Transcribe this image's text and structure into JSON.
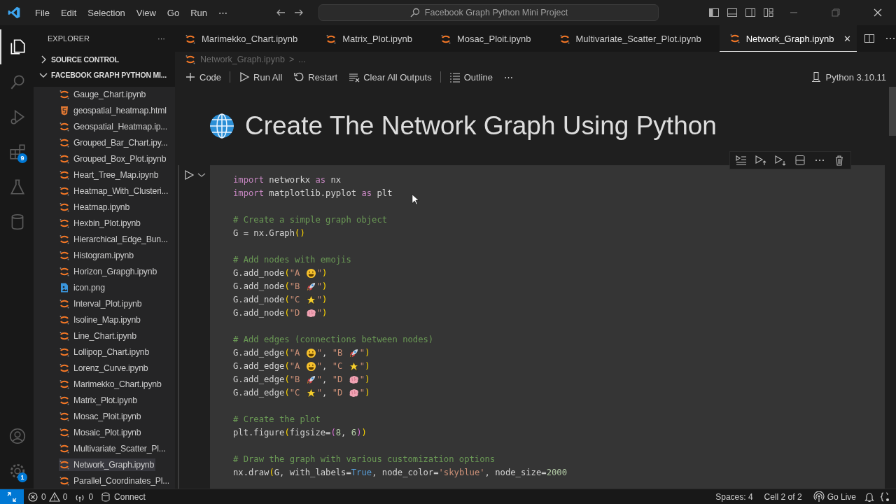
{
  "menu": [
    "File",
    "Edit",
    "Selection",
    "View",
    "Go",
    "Run",
    "⋯"
  ],
  "search": {
    "value": "Facebook Graph Python Mini Project"
  },
  "activity": [
    {
      "selected": true
    },
    {
      "selected": false
    },
    {
      "selected": false
    },
    {
      "selected": false,
      "badge": "9"
    },
    {
      "selected": false
    },
    {
      "selected": false
    }
  ],
  "activity_bottom": [
    {
      "selected": false
    },
    {
      "selected": false,
      "badge": "1"
    }
  ],
  "explorer": {
    "title": "EXPLORER",
    "more": "···",
    "sections": [
      {
        "label": "SOURCE CONTROL",
        "expanded": false
      },
      {
        "label": "FACEBOOK GRAPH PYTHON MI...",
        "expanded": true
      }
    ],
    "files": [
      {
        "name": "Gauge_Chart.ipynb",
        "kind": "notebook",
        "selected": false
      },
      {
        "name": "geospatial_heatmap.html",
        "kind": "html",
        "selected": false
      },
      {
        "name": "Geospatial_Heatmap.ip...",
        "kind": "notebook",
        "selected": false
      },
      {
        "name": "Grouped_Bar_Chart.ipy...",
        "kind": "notebook",
        "selected": false
      },
      {
        "name": "Grouped_Box_Plot.ipynb",
        "kind": "notebook",
        "selected": false
      },
      {
        "name": "Heart_Tree_Map.ipynb",
        "kind": "notebook",
        "selected": false
      },
      {
        "name": "Heatmap_With_Clusteri...",
        "kind": "notebook",
        "selected": false
      },
      {
        "name": "Heatmap.ipynb",
        "kind": "notebook",
        "selected": false
      },
      {
        "name": "Hexbin_Plot.ipynb",
        "kind": "notebook",
        "selected": false
      },
      {
        "name": "Hierarchical_Edge_Bun...",
        "kind": "notebook",
        "selected": false
      },
      {
        "name": "Histogram.ipynb",
        "kind": "notebook",
        "selected": false
      },
      {
        "name": "Horizon_Grapgh.ipynb",
        "kind": "notebook",
        "selected": false
      },
      {
        "name": "icon.png",
        "kind": "image",
        "selected": false
      },
      {
        "name": "Interval_Plot.ipynb",
        "kind": "notebook",
        "selected": false
      },
      {
        "name": "Isoline_Map.ipynb",
        "kind": "notebook",
        "selected": false
      },
      {
        "name": "Line_Chart.ipynb",
        "kind": "notebook",
        "selected": false
      },
      {
        "name": "Lollipop_Chart.ipynb",
        "kind": "notebook",
        "selected": false
      },
      {
        "name": "Lorenz_Curve.ipynb",
        "kind": "notebook",
        "selected": false
      },
      {
        "name": "Marimekko_Chart.ipynb",
        "kind": "notebook",
        "selected": false
      },
      {
        "name": "Matrix_Plot.ipynb",
        "kind": "notebook",
        "selected": false
      },
      {
        "name": "Mosac_Ploit.ipynb",
        "kind": "notebook",
        "selected": false
      },
      {
        "name": "Mosaic_Plot.ipynb",
        "kind": "notebook",
        "selected": false
      },
      {
        "name": "Multivariate_Scatter_Pl...",
        "kind": "notebook",
        "selected": false
      },
      {
        "name": "Network_Graph.ipynb",
        "kind": "notebook",
        "selected": true
      },
      {
        "name": "Parallel_Coordinates_Pl...",
        "kind": "notebook",
        "selected": false
      }
    ]
  },
  "tabs": [
    {
      "label": "Marimekko_Chart.ipynb",
      "selected": false
    },
    {
      "label": "Matrix_Plot.ipynb",
      "selected": false
    },
    {
      "label": "Mosac_Ploit.ipynb",
      "selected": false
    },
    {
      "label": "Multivariate_Scatter_Plot.ipynb",
      "selected": false
    },
    {
      "label": "Network_Graph.ipynb",
      "selected": true,
      "close": "✕"
    }
  ],
  "breadcrumb": [
    "Network_Graph.ipynb",
    ">",
    "..."
  ],
  "toolbar": [
    "Code",
    "Run All",
    "Restart",
    "Clear All Outputs",
    "Outline",
    "⋯"
  ],
  "kernel": "Python 3.10.11",
  "heading": "Create The Network Graph Using Python",
  "code": [
    [
      [
        {
          "kind": "kw",
          "text": "import"
        },
        {
          "kind": "p",
          "text": " networkx "
        },
        {
          "kind": "kw",
          "text": "as"
        },
        {
          "kind": "p",
          "text": " nx"
        }
      ],
      [
        {
          "kind": "kw",
          "text": "import"
        },
        {
          "kind": "p",
          "text": " matplotlib.pyplot "
        },
        {
          "kind": "kw",
          "text": "as"
        },
        {
          "kind": "p",
          "text": " plt"
        }
      ]
    ],
    [
      [
        {
          "kind": "com",
          "text": "# Create a simple graph object"
        }
      ],
      [
        {
          "kind": "p",
          "text": "G = nx.Graph"
        },
        {
          "kind": "br",
          "text": "()"
        }
      ]
    ],
    [
      [
        {
          "kind": "com",
          "text": "# Add nodes with emojis"
        }
      ],
      [
        {
          "kind": "p",
          "text": "G.add_node"
        },
        {
          "kind": "br",
          "text": "("
        },
        {
          "kind": "str",
          "text": "\"A "
        },
        {
          "kind": "smiley"
        },
        {
          "kind": "str",
          "text": "\""
        },
        {
          "kind": "br",
          "text": ")"
        }
      ],
      [
        {
          "kind": "p",
          "text": "G.add_node"
        },
        {
          "kind": "br",
          "text": "("
        },
        {
          "kind": "str",
          "text": "\"B "
        },
        {
          "kind": "rocket"
        },
        {
          "kind": "str",
          "text": "\""
        },
        {
          "kind": "br",
          "text": ")"
        }
      ],
      [
        {
          "kind": "p",
          "text": "G.add_node"
        },
        {
          "kind": "br",
          "text": "("
        },
        {
          "kind": "str",
          "text": "\"C "
        },
        {
          "kind": "star"
        },
        {
          "kind": "str",
          "text": "\""
        },
        {
          "kind": "br",
          "text": ")"
        }
      ],
      [
        {
          "kind": "p",
          "text": "G.add_node"
        },
        {
          "kind": "br",
          "text": "("
        },
        {
          "kind": "str",
          "text": "\"D "
        },
        {
          "kind": "brain"
        },
        {
          "kind": "str",
          "text": "\""
        },
        {
          "kind": "br",
          "text": ")"
        }
      ]
    ],
    [
      [
        {
          "kind": "com",
          "text": "# Add edges (connections between nodes)"
        }
      ],
      [
        {
          "kind": "p",
          "text": "G.add_edge"
        },
        {
          "kind": "br",
          "text": "("
        },
        {
          "kind": "str",
          "text": "\"A "
        },
        {
          "kind": "smiley"
        },
        {
          "kind": "str",
          "text": "\""
        },
        {
          "kind": "p",
          "text": ", "
        },
        {
          "kind": "str",
          "text": "\"B "
        },
        {
          "kind": "rocket"
        },
        {
          "kind": "str",
          "text": "\""
        },
        {
          "kind": "br",
          "text": ")"
        }
      ],
      [
        {
          "kind": "p",
          "text": "G.add_edge"
        },
        {
          "kind": "br",
          "text": "("
        },
        {
          "kind": "str",
          "text": "\"A "
        },
        {
          "kind": "smiley"
        },
        {
          "kind": "str",
          "text": "\""
        },
        {
          "kind": "p",
          "text": ", "
        },
        {
          "kind": "str",
          "text": "\"C "
        },
        {
          "kind": "star"
        },
        {
          "kind": "str",
          "text": "\""
        },
        {
          "kind": "br",
          "text": ")"
        }
      ],
      [
        {
          "kind": "p",
          "text": "G.add_edge"
        },
        {
          "kind": "br",
          "text": "("
        },
        {
          "kind": "str",
          "text": "\"B "
        },
        {
          "kind": "rocket"
        },
        {
          "kind": "str",
          "text": "\""
        },
        {
          "kind": "p",
          "text": ", "
        },
        {
          "kind": "str",
          "text": "\"D "
        },
        {
          "kind": "brain"
        },
        {
          "kind": "str",
          "text": "\""
        },
        {
          "kind": "br",
          "text": ")"
        }
      ],
      [
        {
          "kind": "p",
          "text": "G.add_edge"
        },
        {
          "kind": "br",
          "text": "("
        },
        {
          "kind": "str",
          "text": "\"C "
        },
        {
          "kind": "star"
        },
        {
          "kind": "str",
          "text": "\""
        },
        {
          "kind": "p",
          "text": ", "
        },
        {
          "kind": "str",
          "text": "\"D "
        },
        {
          "kind": "brain"
        },
        {
          "kind": "str",
          "text": "\""
        },
        {
          "kind": "br",
          "text": ")"
        }
      ]
    ],
    [
      [
        {
          "kind": "com",
          "text": "# Create the plot"
        }
      ],
      [
        {
          "kind": "p",
          "text": "plt.figure"
        },
        {
          "kind": "br",
          "text": "("
        },
        {
          "kind": "p",
          "text": "figsize="
        },
        {
          "kind": "br2",
          "text": "("
        },
        {
          "kind": "num",
          "text": "8"
        },
        {
          "kind": "p",
          "text": ", "
        },
        {
          "kind": "num",
          "text": "6"
        },
        {
          "kind": "br2",
          "text": ")"
        },
        {
          "kind": "br",
          "text": ")"
        }
      ]
    ],
    [
      [
        {
          "kind": "com",
          "text": "# Draw the graph with various customization options"
        }
      ],
      [
        {
          "kind": "p",
          "text": "nx.draw"
        },
        {
          "kind": "br",
          "text": "("
        },
        {
          "kind": "p",
          "text": "G, with_labels="
        },
        {
          "kind": "bool",
          "text": "True"
        },
        {
          "kind": "p",
          "text": ", node_color="
        },
        {
          "kind": "str",
          "text": "'skyblue'"
        },
        {
          "kind": "p",
          "text": ", node_size="
        },
        {
          "kind": "num",
          "text": "2000"
        }
      ]
    ]
  ],
  "status": {
    "problems": [
      "0",
      "0"
    ],
    "ports": "0",
    "connect": "Connect",
    "right": [
      "Spaces: 4",
      "Cell 2 of 2",
      "Go Live"
    ]
  }
}
